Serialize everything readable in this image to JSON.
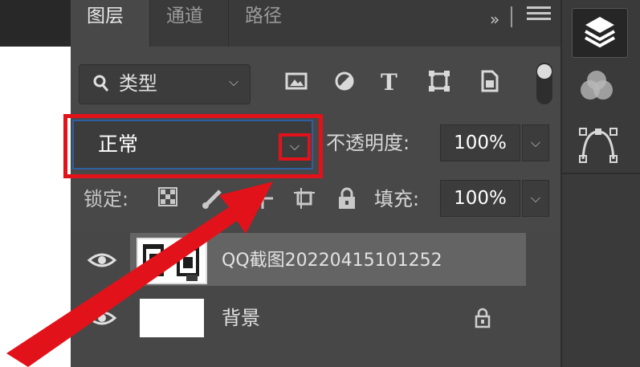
{
  "panel": {
    "tabs": [
      "图层",
      "通道",
      "路径"
    ],
    "more_glyph": "»",
    "active_tab": "图层"
  },
  "filter": {
    "label": "类型",
    "search_glyph": "⚲",
    "chevron_glyph": "⌵",
    "icons": [
      "image-filter-icon",
      "adjustment-filter-icon",
      "type-filter-icon",
      "shape-filter-icon",
      "smart-object-filter-icon"
    ],
    "type_glyph": "T"
  },
  "blend": {
    "value": "正常",
    "chevron_glyph": "⌵",
    "opacity_label": "不透明度:",
    "opacity_value": "100%",
    "opacity_chevron": "⌵"
  },
  "lock": {
    "label": "锁定:",
    "fill_label": "填充:",
    "fill_value": "100%",
    "fill_chevron": "⌵"
  },
  "layers": [
    {
      "name": "QQ截图20220415101252",
      "visible": true,
      "selected": true
    },
    {
      "name": "背景",
      "visible": true,
      "selected": false,
      "locked": true
    }
  ],
  "colors": {
    "annotation_red": "#e2121a",
    "selection_blue": "#2e5fa3",
    "panel_bg": "#484848"
  }
}
